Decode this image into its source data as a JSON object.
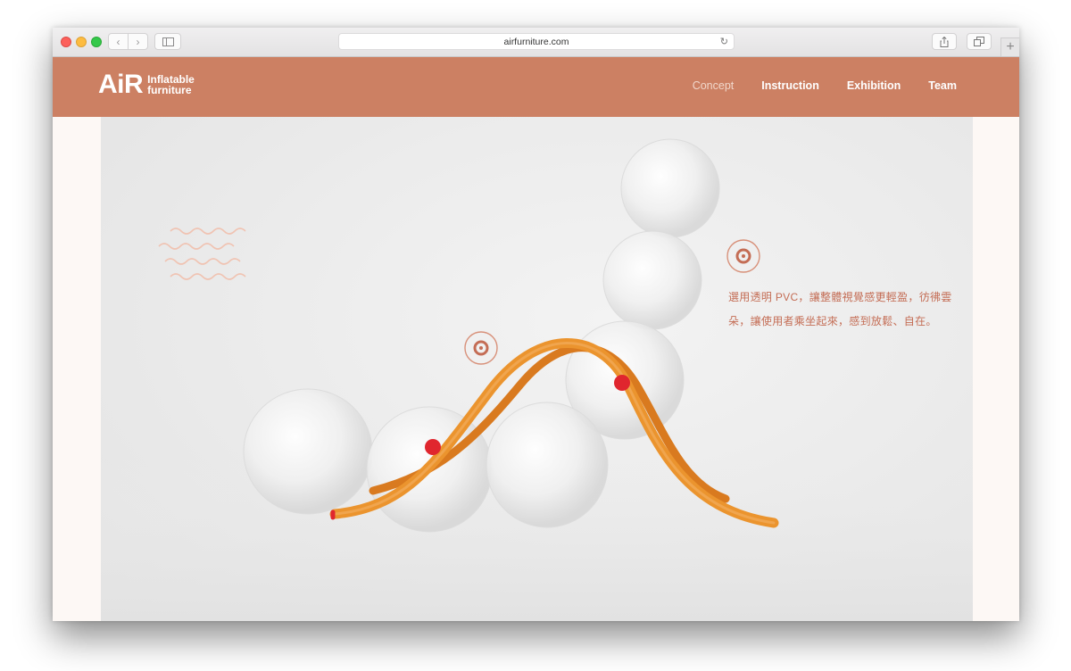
{
  "browser": {
    "url": "airfurniture.com",
    "icons": {
      "back": "chevron-left-icon",
      "forward": "chevron-right-icon",
      "sidebar": "sidebar-icon",
      "reload": "reload-icon",
      "share": "share-icon",
      "tabs": "tabs-overview-icon",
      "new_tab": "plus-icon"
    }
  },
  "site": {
    "logo": {
      "mark": "AiR",
      "line1": "Inflatable",
      "line2": "furniture"
    },
    "nav": [
      "Concept",
      "Instruction",
      "Exhibition",
      "Team"
    ],
    "active_nav": "Concept"
  },
  "hero": {
    "description": [
      "選用透明 PVC，讓整體視覺感更輕盈，彷彿雲",
      "朵，讓使用者乘坐起來，感到放鬆、自在。"
    ]
  },
  "colors": {
    "brand": "#cc8063",
    "accent_text": "#c46d55",
    "frame_orange": "#e8902e",
    "joint_red": "#e0262e"
  }
}
